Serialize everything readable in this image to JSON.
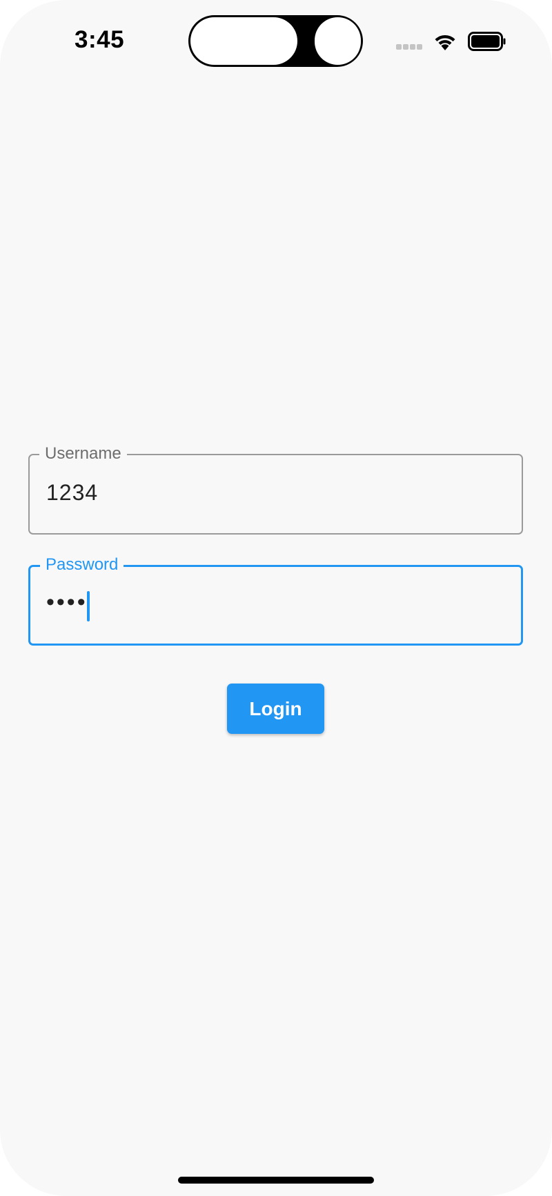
{
  "status_bar": {
    "time": "3:45"
  },
  "form": {
    "username": {
      "label": "Username",
      "value": "1234"
    },
    "password": {
      "label": "Password",
      "masked_value": "••••"
    },
    "login_button": {
      "label": "Login"
    }
  },
  "colors": {
    "accent": "#2196f3",
    "background": "#f8f8f8",
    "idle_border": "#9a9a9a"
  },
  "icons": [
    "wifi-icon",
    "battery-icon",
    "cellular-signal-icon"
  ]
}
